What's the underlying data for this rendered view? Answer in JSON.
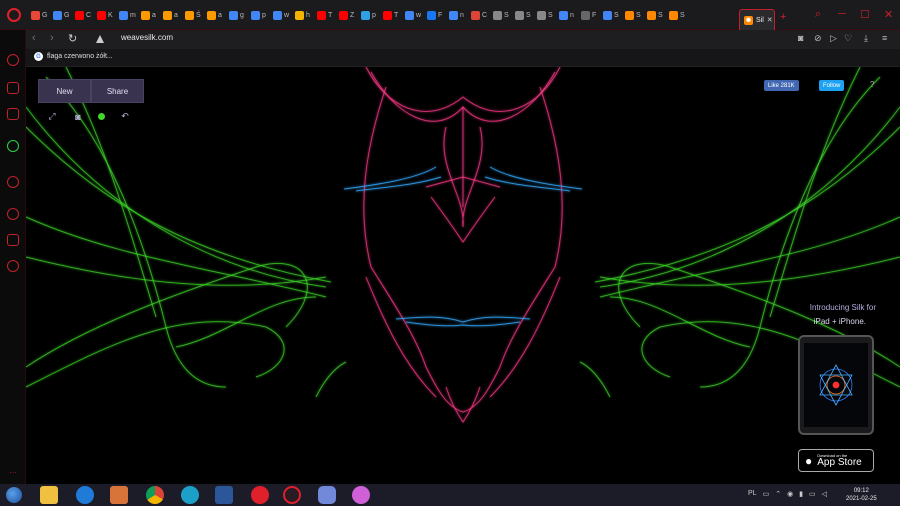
{
  "browser": {
    "tabs": [
      {
        "letter": "G",
        "color": "#e8483a"
      },
      {
        "letter": "G",
        "color": "#4285f4"
      },
      {
        "letter": "C",
        "color": "#ff0000"
      },
      {
        "letter": "K",
        "color": "#ff0000"
      },
      {
        "letter": "m",
        "color": "#4285f4"
      },
      {
        "letter": "a",
        "color": "#ff9900"
      },
      {
        "letter": "a",
        "color": "#ff9900"
      },
      {
        "letter": "Ś",
        "color": "#ff9900"
      },
      {
        "letter": "a",
        "color": "#ff9900"
      },
      {
        "letter": "g",
        "color": "#4285f4"
      },
      {
        "letter": "p",
        "color": "#4285f4"
      },
      {
        "letter": "w",
        "color": "#4285f4"
      },
      {
        "letter": "h",
        "color": "#f4b400"
      },
      {
        "letter": "T",
        "color": "#ff0000"
      },
      {
        "letter": "Z",
        "color": "#ff0000"
      },
      {
        "letter": "p",
        "color": "#2fa0e6"
      },
      {
        "letter": "T",
        "color": "#ff0000"
      },
      {
        "letter": "w",
        "color": "#4285f4"
      },
      {
        "letter": "F",
        "color": "#1877f2"
      },
      {
        "letter": "n",
        "color": "#4285f4"
      },
      {
        "letter": "C",
        "color": "#db4437"
      },
      {
        "letter": "S",
        "color": "#888888"
      },
      {
        "letter": "S",
        "color": "#888888"
      },
      {
        "letter": "S",
        "color": "#888888"
      },
      {
        "letter": "n",
        "color": "#4285f4"
      },
      {
        "letter": "F",
        "color": "#666666"
      },
      {
        "letter": "S",
        "color": "#4285f4"
      },
      {
        "letter": "S",
        "color": "#ff8800"
      },
      {
        "letter": "S",
        "color": "#ff8800"
      },
      {
        "letter": "S",
        "color": "#ff8800"
      }
    ],
    "active_tab": {
      "label": "Sil",
      "close": "✕"
    },
    "new_tab": "+",
    "window_controls": {
      "search": "⌕",
      "minimize": "─",
      "maximize": "☐",
      "close": "✕"
    },
    "nav": {
      "back": "‹",
      "forward": "›",
      "reload": "↻"
    },
    "url": "weavesilk.com",
    "bookmark": "flaga czerwono żółt..."
  },
  "page": {
    "new_label": "New",
    "share_label": "Share",
    "tools": {
      "fullscreen": "⤢",
      "camera": "◙",
      "undo": "↶"
    },
    "fb_like": "Like 281K",
    "tw_follow": "Follow",
    "help": "?",
    "promo_line1": "Introducing Silk for",
    "promo_line2": "iPad + iPhone.",
    "appstore_small": "Download on the",
    "appstore_big": "App Store"
  },
  "taskbar": {
    "lang": "PL",
    "time": "09:12",
    "date": "2021-02-25"
  },
  "colors": {
    "accent": "#c2202a",
    "silk_green": "#3fe02a",
    "silk_pink": "#ff3a8a",
    "silk_blue": "#33aaff"
  }
}
